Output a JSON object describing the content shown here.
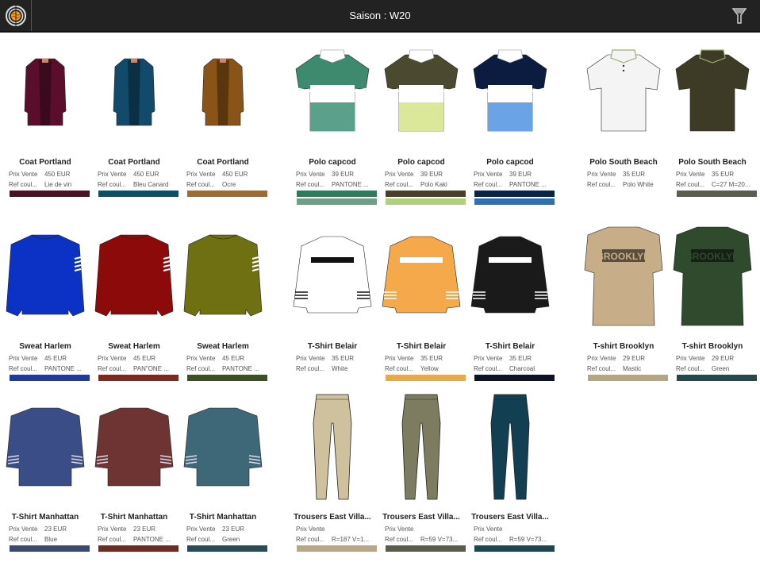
{
  "header": {
    "title": "Saison : W20",
    "logo_icon": "brand-logo-icon",
    "filter_icon": "filter-icon"
  },
  "labels": {
    "price": "Prix Vente",
    "color_ref": "Ref coul..."
  },
  "products": [
    {
      "name": "Coat Portland",
      "price": "450 EUR",
      "color": "Lie de vin",
      "swatches": [
        "#4a1324"
      ],
      "type": "coat",
      "fill": "#5a0e2c"
    },
    {
      "name": "Coat Portland",
      "price": "450 EUR",
      "color": "Bleu Canard",
      "swatches": [
        "#0f4f63"
      ],
      "type": "coat",
      "fill": "#124a6b"
    },
    {
      "name": "Coat Portland",
      "price": "450 EUR",
      "color": "Ocre",
      "swatches": [
        "#9c6b3a"
      ],
      "type": "coat",
      "fill": "#8a5317"
    },
    {
      "name": "Polo capcod",
      "price": "39 EUR",
      "color": "PANTONE ...",
      "swatches": [
        "#317a5e",
        "#6e9e8a"
      ],
      "type": "polo-stripe",
      "fill": "#3d8a6e",
      "fill2": "#5ba08a"
    },
    {
      "name": "Polo capcod",
      "price": "39 EUR",
      "color": "Polo Kaki",
      "swatches": [
        "#4a3f2c",
        "#b1d07b"
      ],
      "type": "polo-stripe",
      "fill": "#4b4a30",
      "fill2": "#dbe89a"
    },
    {
      "name": "Polo capcod",
      "price": "39 EUR",
      "color": "PANTONE ...",
      "swatches": [
        "#0a2448",
        "#2e6fba"
      ],
      "type": "polo-stripe",
      "fill": "#0c1c40",
      "fill2": "#6ba4e6"
    },
    {
      "name": "Polo South Beach",
      "price": "35 EUR",
      "color": "Polo White",
      "swatches": [],
      "type": "polo",
      "fill": "#f4f4f4"
    },
    {
      "name": "Polo South Beach",
      "price": "35 EUR",
      "color": "C=27 M=20...",
      "swatches": [
        "#5c5d4f"
      ],
      "type": "polo",
      "fill": "#3d3a26"
    },
    {
      "name": "Sweat Harlem",
      "price": "45 EUR",
      "color": "PANTONE ...",
      "swatches": [
        "#23399a"
      ],
      "type": "sweat",
      "fill": "#0b32c4"
    },
    {
      "name": "Sweat Harlem",
      "price": "45 EUR",
      "color": "PAN\"ONE ...",
      "swatches": [
        "#7d2a22"
      ],
      "type": "sweat",
      "fill": "#8c0a0a"
    },
    {
      "name": "Sweat Harlem",
      "price": "45 EUR",
      "color": "PANTONE ...",
      "swatches": [
        "#3e4e26"
      ],
      "type": "sweat",
      "fill": "#6f7012"
    },
    {
      "name": "T-Shirt Belair",
      "price": "35 EUR",
      "color": "White",
      "swatches": [],
      "type": "belair",
      "fill": "#ffffff",
      "band": "#111111"
    },
    {
      "name": "T-Shirt Belair",
      "price": "35 EUR",
      "color": "Yellow",
      "swatches": [
        "#e8a94d"
      ],
      "type": "belair",
      "fill": "#f6a94a",
      "band": "#ffffff"
    },
    {
      "name": "T-Shirt Belair",
      "price": "35 EUR",
      "color": "Charcoal",
      "swatches": [
        "#0d1322"
      ],
      "type": "belair",
      "fill": "#1a1a1a",
      "band": "#ffffff"
    },
    {
      "name": "T-shirt Brooklyn",
      "price": "29 EUR",
      "color": "Mastic",
      "swatches": [
        "#b5a485"
      ],
      "type": "brooklyn",
      "fill": "#c7ad88"
    },
    {
      "name": "T-shirt Brooklyn",
      "price": "29 EUR",
      "color": "Green",
      "swatches": [
        "#27474c"
      ],
      "type": "brooklyn",
      "fill": "#2f4a2d"
    },
    {
      "name": "T-Shirt Manhattan",
      "price": "23 EUR",
      "color": "Blue",
      "swatches": [
        "#3d4a6e"
      ],
      "type": "tee",
      "fill": "#3b4d86"
    },
    {
      "name": "T-Shirt Manhattan",
      "price": "23 EUR",
      "color": "PANTONE ...",
      "swatches": [
        "#6e2a26"
      ],
      "type": "tee",
      "fill": "#6e3434"
    },
    {
      "name": "T-Shirt Manhattan",
      "price": "23 EUR",
      "color": "Green",
      "swatches": [
        "#2b4a55"
      ],
      "type": "tee",
      "fill": "#3e6878"
    },
    {
      "name": "Trousers East Villa...",
      "price": "",
      "color": "R=187 V=1...",
      "swatches": [
        "#b7a78a"
      ],
      "type": "trousers",
      "fill": "#cfc19e"
    },
    {
      "name": "Trousers East Villa...",
      "price": "",
      "color": "R=59 V=73...",
      "swatches": [
        "#5c5c4e"
      ],
      "type": "trousers",
      "fill": "#7d7c61"
    },
    {
      "name": "Trousers East Villa...",
      "price": "",
      "color": "R=59 V=73...",
      "swatches": [
        "#1f4650"
      ],
      "type": "trousers",
      "fill": "#123f52"
    }
  ]
}
